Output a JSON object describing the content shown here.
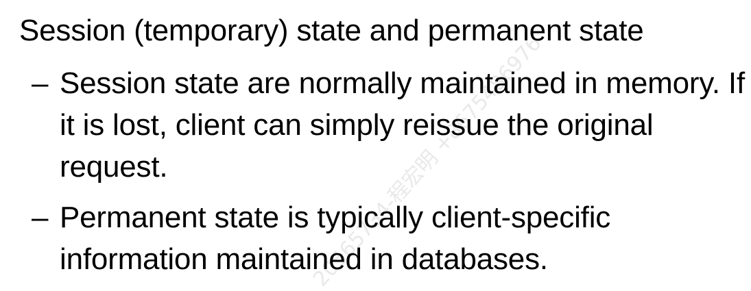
{
  "slide": {
    "heading": "Session (temporary) state and permanent state",
    "bullets": [
      {
        "marker": "–",
        "text": "Session state are normally maintained in memory. If it is lost, client can simply reissue the original request."
      },
      {
        "marker": "–",
        "text": "Permanent state is typically client-specific information maintained in databases."
      }
    ]
  },
  "watermark": {
    "text": "20565734-程宏明 +8675486976"
  }
}
